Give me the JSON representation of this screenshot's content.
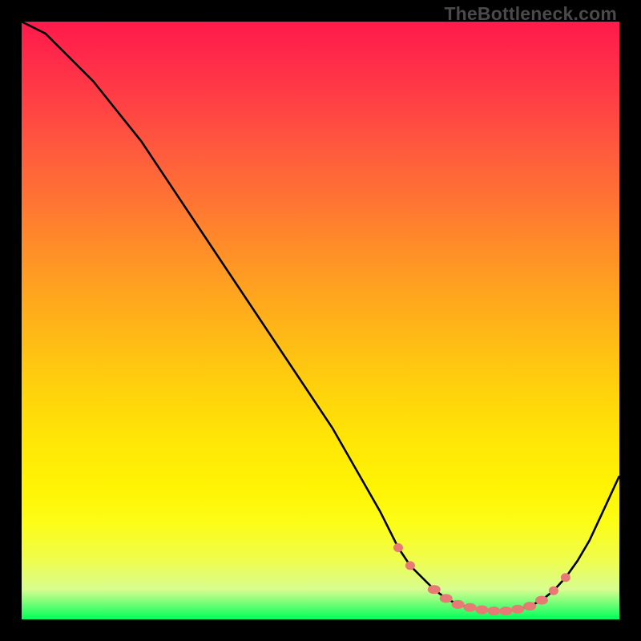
{
  "watermark": "TheBottleneck.com",
  "chart_data": {
    "type": "line",
    "title": "",
    "xlabel": "",
    "ylabel": "",
    "xlim": [
      0,
      100
    ],
    "ylim": [
      0,
      100
    ],
    "series": [
      {
        "name": "bottleneck-curve",
        "x": [
          0,
          4,
          8,
          12,
          16,
          20,
          24,
          28,
          32,
          36,
          40,
          44,
          48,
          52,
          56,
          60,
          63,
          65,
          67,
          69,
          71,
          73,
          75,
          77,
          79,
          81,
          83,
          85,
          87,
          89,
          91,
          93,
          95,
          97,
          100
        ],
        "y": [
          100,
          98,
          94,
          90,
          85,
          80,
          74,
          68,
          62,
          56,
          50,
          44,
          38,
          32,
          25,
          18,
          12,
          9,
          7,
          5,
          3.5,
          2.5,
          2,
          1.6,
          1.4,
          1.4,
          1.7,
          2.2,
          3.2,
          4.8,
          7,
          9.8,
          13.2,
          17.5,
          24
        ]
      },
      {
        "name": "marker-dots",
        "x": [
          63,
          65,
          69,
          71,
          73,
          75,
          77,
          79,
          81,
          83,
          85,
          87,
          89,
          91
        ],
        "y": [
          12,
          9,
          5,
          3.5,
          2.5,
          2,
          1.6,
          1.4,
          1.4,
          1.7,
          2.2,
          3.2,
          4.8,
          7
        ]
      }
    ],
    "colors": {
      "curve": "#000000",
      "dots": "#e77a74",
      "gradient_top": "#ff1a4b",
      "gradient_bottom": "#00ff5a"
    }
  }
}
